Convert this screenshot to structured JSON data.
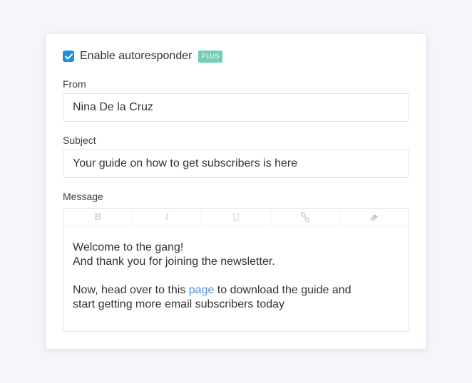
{
  "autoresponder": {
    "enabled": true,
    "label": "Enable autoresponder",
    "badge": "PLUS"
  },
  "from": {
    "label": "From",
    "value": "Nina De la Cruz"
  },
  "subject": {
    "label": "Subject",
    "value": "Your guide on how to get subscribers is here"
  },
  "message": {
    "label": "Message",
    "toolbar": {
      "bold": "B",
      "italic": "I",
      "underline": "U",
      "link_icon": "link-icon",
      "eraser_icon": "eraser-icon"
    },
    "line1": "Welcome to the gang!",
    "line2": "And thank you for joining the newsletter.",
    "line3_before": "Now, head over to this ",
    "line3_link": "page",
    "line3_after": " to download the guide and",
    "line4": "start getting more email subscribers today"
  },
  "colors": {
    "checkbox": "#1e8ee0",
    "badge": "#6fd0b5",
    "link": "#4f8fcf"
  }
}
